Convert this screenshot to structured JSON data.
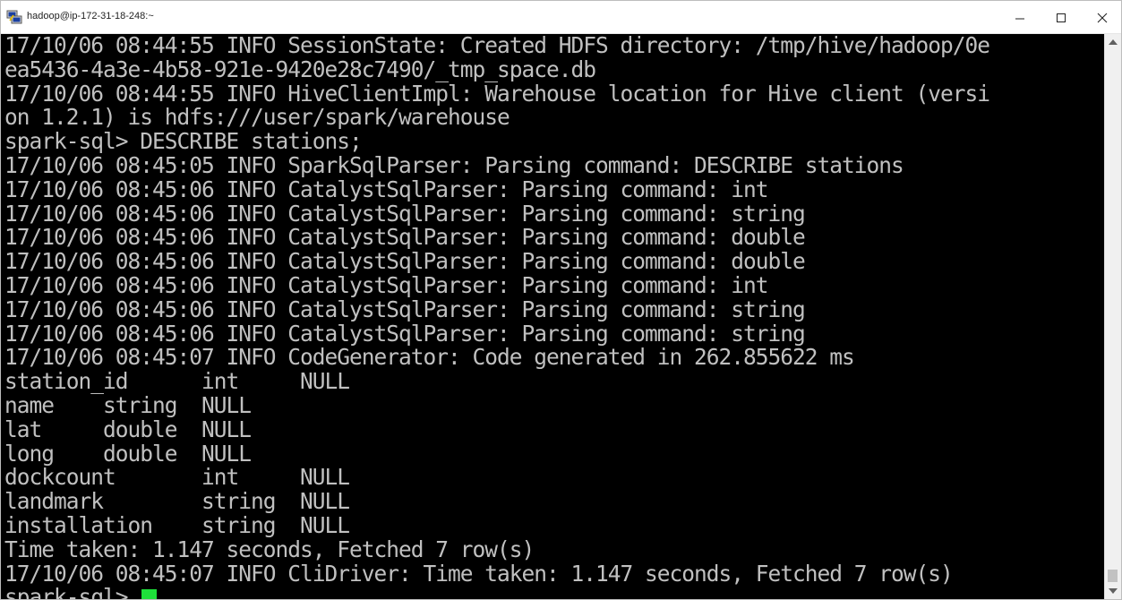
{
  "window": {
    "title": "hadoop@ip-172-31-18-248:~",
    "icon": "putty-icon",
    "controls": {
      "minimize": "minimize-icon",
      "maximize": "maximize-icon",
      "close": "close-icon"
    }
  },
  "terminal": {
    "colors": {
      "background": "#000000",
      "foreground": "#c0c0c0",
      "cursor": "#1ee03a"
    },
    "lines": [
      "17/10/06 08:44:55 INFO SessionState: Created HDFS directory: /tmp/hive/hadoop/0e",
      "ea5436-4a3e-4b58-921e-9420e28c7490/_tmp_space.db",
      "17/10/06 08:44:55 INFO HiveClientImpl: Warehouse location for Hive client (versi",
      "on 1.2.1) is hdfs:///user/spark/warehouse",
      "spark-sql> DESCRIBE stations;",
      "17/10/06 08:45:05 INFO SparkSqlParser: Parsing command: DESCRIBE stations",
      "17/10/06 08:45:06 INFO CatalystSqlParser: Parsing command: int",
      "17/10/06 08:45:06 INFO CatalystSqlParser: Parsing command: string",
      "17/10/06 08:45:06 INFO CatalystSqlParser: Parsing command: double",
      "17/10/06 08:45:06 INFO CatalystSqlParser: Parsing command: double",
      "17/10/06 08:45:06 INFO CatalystSqlParser: Parsing command: int",
      "17/10/06 08:45:06 INFO CatalystSqlParser: Parsing command: string",
      "17/10/06 08:45:06 INFO CatalystSqlParser: Parsing command: string",
      "17/10/06 08:45:07 INFO CodeGenerator: Code generated in 262.855622 ms",
      "station_id      int     NULL",
      "name    string  NULL",
      "lat     double  NULL",
      "long    double  NULL",
      "dockcount       int     NULL",
      "landmark        string  NULL",
      "installation    string  NULL",
      "Time taken: 1.147 seconds, Fetched 7 row(s)",
      "17/10/06 08:45:07 INFO CliDriver: Time taken: 1.147 seconds, Fetched 7 row(s)"
    ],
    "prompt": "spark-sql> "
  },
  "scrollbar": {
    "up": "scroll-up-arrow",
    "down": "scroll-down-arrow"
  }
}
